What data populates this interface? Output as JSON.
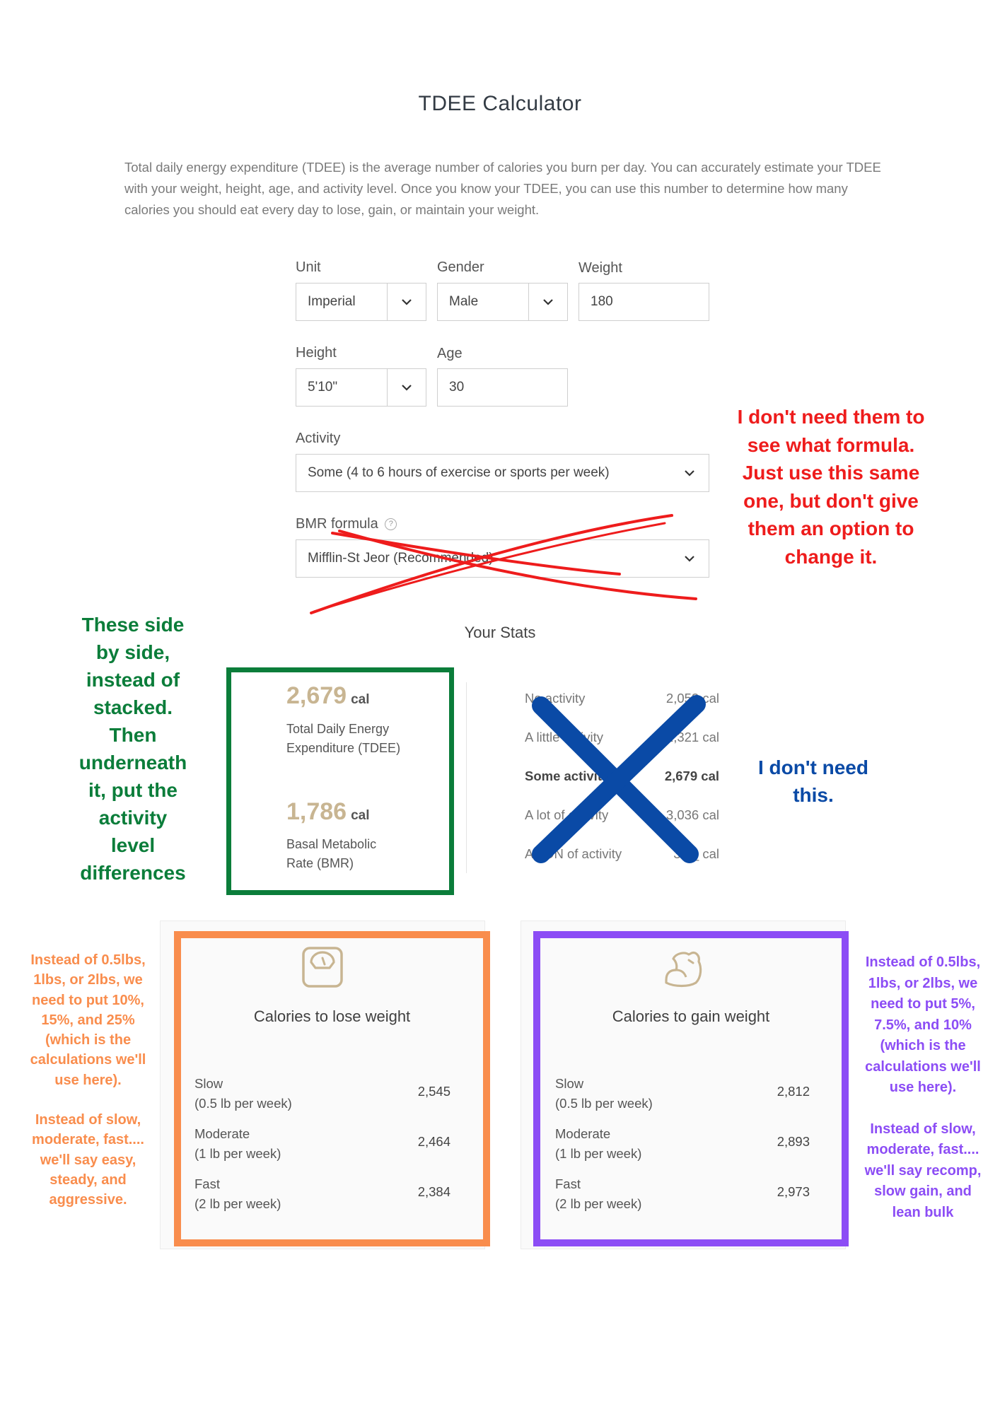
{
  "page": {
    "title": "TDEE Calculator",
    "intro": "Total daily energy expenditure (TDEE) is the average number of calories you burn per day. You can accurately estimate your TDEE with your weight, height, age, and activity level. Once you know your TDEE, you can use this number to determine how many calories you should eat every day to lose, gain, or maintain your weight."
  },
  "form": {
    "unit": {
      "label": "Unit",
      "value": "Imperial"
    },
    "gender": {
      "label": "Gender",
      "value": "Male"
    },
    "weight": {
      "label": "Weight",
      "value": "180"
    },
    "height": {
      "label": "Height",
      "value": "5'10\""
    },
    "age": {
      "label": "Age",
      "value": "30"
    },
    "activity": {
      "label": "Activity",
      "value": "Some (4 to 6 hours of exercise or sports per week)"
    },
    "bmr_formula": {
      "label": "BMR formula",
      "value": "Mifflin-St Jeor (Recommended)"
    }
  },
  "stats": {
    "title": "Your Stats",
    "tdee": {
      "value": "2,679",
      "unit": "cal",
      "desc_line1": "Total Daily Energy",
      "desc_line2": "Expenditure (TDEE)"
    },
    "bmr": {
      "value": "1,786",
      "unit": "cal",
      "desc_line1": "Basal Metabolic",
      "desc_line2": "Rate (BMR)"
    },
    "activity_levels": [
      {
        "label": "No activity",
        "value": "2,053 cal"
      },
      {
        "label": "A little activity",
        "value": "2,321 cal"
      },
      {
        "label": "Some activity",
        "value": "2,679 cal"
      },
      {
        "label": "A lot of activity",
        "value": "3,036 cal"
      },
      {
        "label": "A TON of activity",
        "value": "3,3_ cal"
      }
    ]
  },
  "lose": {
    "title": "Calories to lose weight",
    "rows": [
      {
        "name": "Slow",
        "detail": "(0.5 lb per week)",
        "value": "2,545"
      },
      {
        "name": "Moderate",
        "detail": "(1 lb per week)",
        "value": "2,464"
      },
      {
        "name": "Fast",
        "detail": "(2 lb per week)",
        "value": "2,384"
      }
    ]
  },
  "gain": {
    "title": "Calories to gain weight",
    "rows": [
      {
        "name": "Slow",
        "detail": "(0.5 lb per week)",
        "value": "2,812"
      },
      {
        "name": "Moderate",
        "detail": "(1 lb per week)",
        "value": "2,893"
      },
      {
        "name": "Fast",
        "detail": "(2 lb per week)",
        "value": "2,973"
      }
    ]
  },
  "annotations": {
    "formula_note": [
      "I don't need them to",
      "see what formula.",
      "Just use this same",
      "one, but don't give",
      "them an option to",
      "change it."
    ],
    "side_by_side_note": [
      "These side",
      "by side,",
      "instead of",
      "stacked.",
      "Then",
      "underneath",
      "it, put the",
      "activity",
      "level",
      "differences"
    ],
    "dont_need_note": [
      "I don't need",
      "this."
    ],
    "lose_note": [
      "Instead of 0.5lbs,",
      "1lbs, or 2lbs, we",
      "need to put 10%,",
      "15%, and 25%",
      "(which is the",
      "calculations we'll",
      "use here).",
      "",
      "Instead of slow,",
      "moderate, fast....",
      "we'll say easy,",
      "steady, and",
      "aggressive."
    ],
    "gain_note": [
      "Instead of 0.5lbs,",
      "1lbs, or 2lbs, we",
      "need to put 5%,",
      "7.5%, and 10%",
      "(which is the",
      "calculations we'll",
      "use here).",
      "",
      "Instead of slow,",
      "moderate, fast....",
      "we'll say recomp,",
      "slow gain, and",
      "lean bulk"
    ]
  },
  "colors": {
    "red": "#ee1c1c",
    "green": "#0b7d3a",
    "blue": "#0a4aa6",
    "orange": "#f98d4d",
    "purple": "#8c4df5",
    "gold": "#c8b592"
  },
  "icons": {
    "lose": "scale-icon",
    "gain": "flexed-arm-icon"
  }
}
